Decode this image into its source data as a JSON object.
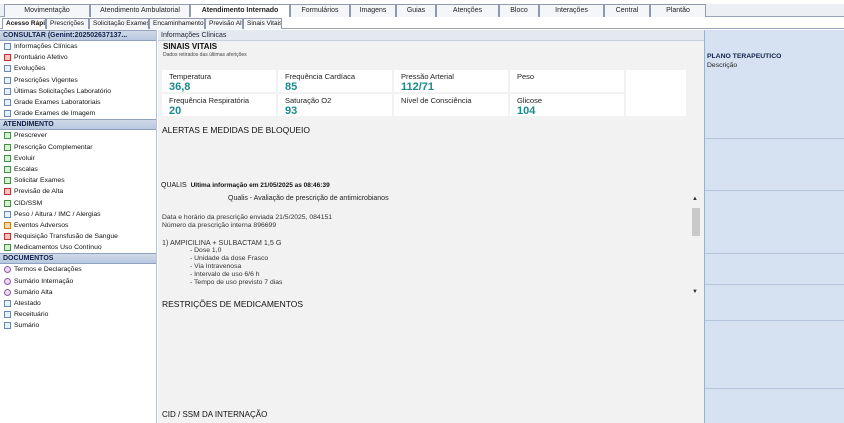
{
  "top_tabs": [
    "Movimentação",
    "Atendimento Ambulatorial",
    "Atendimento Internado",
    "Formulários",
    "Imagens",
    "Guias",
    "Atenções",
    "Bloco",
    "Interações",
    "Central",
    "Plantão"
  ],
  "active_top_tab": "Atendimento Internado",
  "sub_tabs": [
    "Acesso Rápido",
    "Prescrições",
    "Solicitação Exames",
    "Encaminhamento",
    "Previsão Alta",
    "Sinais Vitais"
  ],
  "sidebar": {
    "consultar_header": "CONSULTAR (Genint:202502637137...",
    "consultar_items": [
      "Informações Clínicas",
      "Prontuário Afetivo",
      "Evoluções",
      "Prescrições Vigentes",
      "Últimas Solicitações Laboratório",
      "Grade Exames Laboratoriais",
      "Grade Exames de Imagem"
    ],
    "atendimento_header": "ATENDIMENTO",
    "atendimento_items": [
      "Prescrever",
      "Prescrição Complementar",
      "Evoluir",
      "Escalas",
      "Solicitar Exames",
      "Previsão de Alta",
      "CID/SSM",
      "Peso / Altura / IMC / Alergias",
      "Eventos Adversos",
      "Requisição Transfusão de Sangue",
      "Medicamentos Uso Contínuo"
    ],
    "documentos_header": "DOCUMENTOS",
    "documentos_items": [
      "Termos e Declarações",
      "Sumário Internação",
      "Sumário Alta",
      "Atestado",
      "Receituário",
      "Sumário"
    ]
  },
  "main": {
    "title": "Informações Clínicas",
    "vitals_title": "SINAIS VITAIS",
    "vitals_subtitle": "Dados retirados das últimas aferições",
    "vitals": [
      {
        "label": "Temperatura",
        "value": "36,8"
      },
      {
        "label": "Frequência Cardíaca",
        "value": "85"
      },
      {
        "label": "Pressão Arterial",
        "value": "112/71"
      },
      {
        "label": "Peso",
        "value": ""
      },
      {
        "label": "Frequência Respiratória",
        "value": "20"
      },
      {
        "label": "Saturação O2",
        "value": "93"
      },
      {
        "label": "Nível de Consciência",
        "value": ""
      },
      {
        "label": "Glicose",
        "value": "104"
      }
    ],
    "alerts_heading": "ALERTAS E MEDIDAS DE BLOQUEIO",
    "qualis_label": "QUALIS",
    "qualis_info": "Ultima informação em 21/05/2025 as 08:46:39",
    "qualis_sub": "Qualis - Avaliação de prescrição de antimicrobianos",
    "prescription_lines": [
      "Data e horário da prescrição enviada 21/5/2025, 084151",
      "Número da prescrição interna 896699",
      "",
      "1) AMPICILINA + SULBACTAM 1,5 G",
      "           - Dose 1,0",
      "           - Unidade da dose Frasco",
      "           - Via Intravenosa",
      "           - Intervalo de uso 6/6 h",
      "           - Tempo de uso previsto 7 dias"
    ],
    "restrictions_heading": "RESTRIÇÕES DE MEDICAMENTOS",
    "cid_heading": "CID / SSM DA INTERNAÇÃO"
  },
  "right_panel": {
    "title": "PLANO TERAPEUTICO",
    "subtitle": "Descrição"
  }
}
